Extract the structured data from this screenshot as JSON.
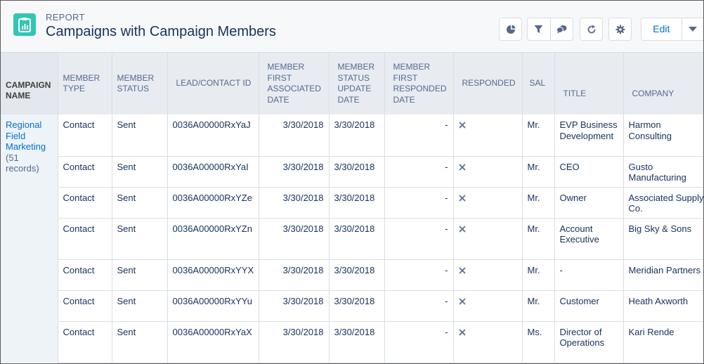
{
  "header": {
    "eyebrow": "REPORT",
    "title": "Campaigns with Campaign Members",
    "edit_label": "Edit"
  },
  "icons": {
    "report": "report-clipboard-icon",
    "chart": "pie-chart-icon",
    "filter": "filter-funnel-icon",
    "conversation": "chat-bubbles-icon",
    "refresh": "refresh-icon",
    "settings": "gear-icon",
    "dropdown": "caret-down-icon",
    "responded_false": "x-mark-icon"
  },
  "colors": {
    "brand_icon": "#32c5b6",
    "link": "#0070d2",
    "header_bg": "#e8ecf1"
  },
  "table": {
    "columns": [
      "CAMPAIGN NAME",
      "MEMBER TYPE",
      "MEMBER STATUS",
      "LEAD/CONTACT ID",
      "MEMBER FIRST ASSOCIATED DATE",
      "MEMBER STATUS UPDATE DATE",
      "MEMBER FIRST RESPONDED DATE",
      "RESPONDED",
      "SAL",
      "TITLE",
      "COMPANY"
    ],
    "group": {
      "name": "Regional Field Marketing",
      "count": "(51 records)"
    },
    "rows": [
      {
        "type": "Contact",
        "status": "Sent",
        "id": "0036A00000RxYaJ",
        "first_assoc": "3/30/2018",
        "status_update": "3/30/2018",
        "first_responded": "-",
        "sal": "Mr.",
        "title": "EVP Business Development",
        "company": "Harmon Consulting"
      },
      {
        "type": "Contact",
        "status": "Sent",
        "id": "0036A00000RxYaI",
        "first_assoc": "3/30/2018",
        "status_update": "3/30/2018",
        "first_responded": "-",
        "sal": "Mr.",
        "title": "CEO",
        "company": "Gusto Manufacturing"
      },
      {
        "type": "Contact",
        "status": "Sent",
        "id": "0036A00000RxYZe",
        "first_assoc": "3/30/2018",
        "status_update": "3/30/2018",
        "first_responded": "-",
        "sal": "Mr.",
        "title": "Owner",
        "company": "Associated Supply Co."
      },
      {
        "type": "Contact",
        "status": "Sent",
        "id": "0036A00000RxYZn",
        "first_assoc": "3/30/2018",
        "status_update": "3/30/2018",
        "first_responded": "-",
        "sal": "Mr.",
        "title": "Account Executive",
        "company": "Big Sky & Sons"
      },
      {
        "type": "Contact",
        "status": "Sent",
        "id": "0036A00000RxYYX",
        "first_assoc": "3/30/2018",
        "status_update": "3/30/2018",
        "first_responded": "-",
        "sal": "Mr.",
        "title": "-",
        "company": "Meridian Partners"
      },
      {
        "type": "Contact",
        "status": "Sent",
        "id": "0036A00000RxYYu",
        "first_assoc": "3/30/2018",
        "status_update": "3/30/2018",
        "first_responded": "-",
        "sal": "Mr.",
        "title": "Customer",
        "company": "Heath Axworth"
      },
      {
        "type": "Contact",
        "status": "Sent",
        "id": "0036A00000RxYaX",
        "first_assoc": "3/30/2018",
        "status_update": "3/30/2018",
        "first_responded": "-",
        "sal": "Ms.",
        "title": "Director of Operations",
        "company": "Kari Rende"
      }
    ]
  }
}
